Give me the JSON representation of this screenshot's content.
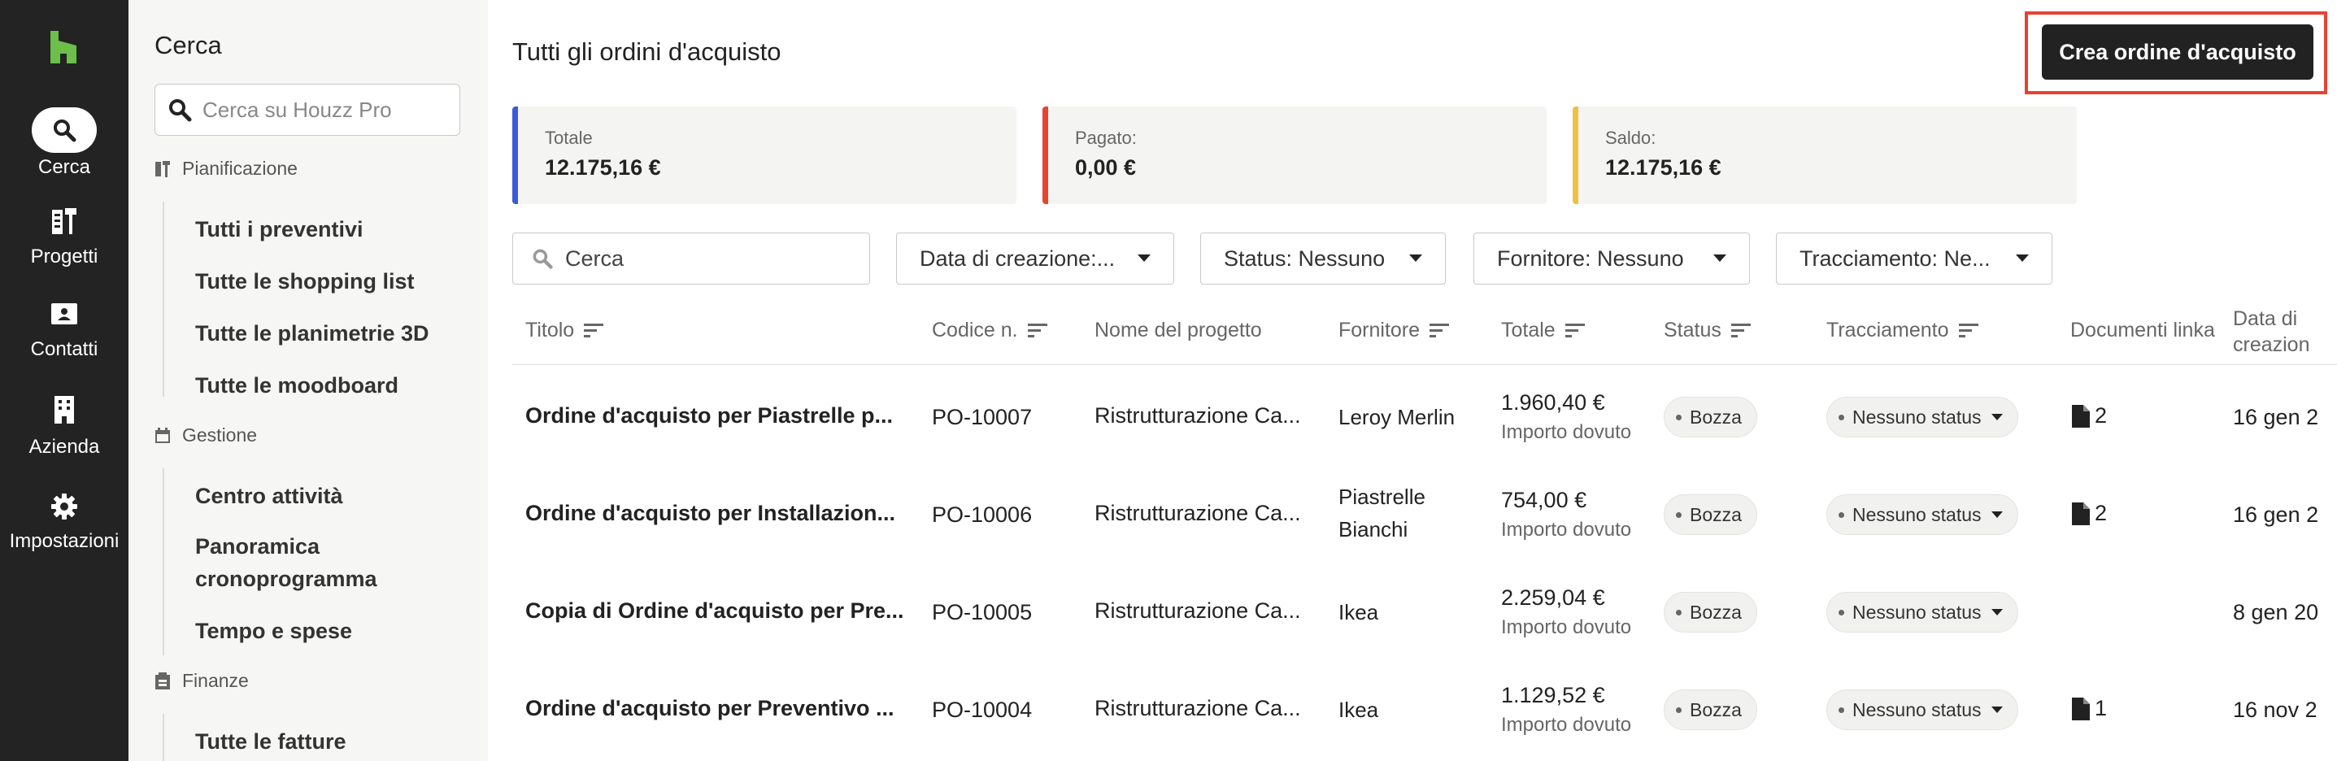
{
  "rail": {
    "items": [
      {
        "label": "Cerca",
        "icon": "search-icon"
      },
      {
        "label": "Progetti",
        "icon": "projects-icon"
      },
      {
        "label": "Contatti",
        "icon": "contacts-icon"
      },
      {
        "label": "Azienda",
        "icon": "building-icon"
      },
      {
        "label": "Impostazioni",
        "icon": "gear-icon"
      }
    ],
    "colors": {
      "bg": "#232323",
      "logo": "#6cbf4b"
    }
  },
  "sidebar": {
    "title": "Cerca",
    "search_placeholder": "Cerca su Houzz Pro",
    "sections": [
      {
        "label": "Pianificazione",
        "items": [
          "Tutti i preventivi",
          "Tutte le shopping list",
          "Tutte le planimetrie 3D",
          "Tutte le moodboard"
        ]
      },
      {
        "label": "Gestione",
        "items": [
          "Centro attività",
          "Panoramica cronoprogramma",
          "Tempo e spese"
        ]
      },
      {
        "label": "Finanze",
        "items": [
          "Tutte le fatture"
        ]
      }
    ]
  },
  "main": {
    "title": "Tutti gli ordini d'acquisto",
    "create_button": "Crea ordine d'acquisto",
    "summary": [
      {
        "label": "Totale",
        "value": "12.175,16 €",
        "color": "#3a5bd9"
      },
      {
        "label": "Pagato:",
        "value": "0,00 €",
        "color": "#e64331"
      },
      {
        "label": "Saldo:",
        "value": "12.175,16 €",
        "color": "#f0c040"
      }
    ],
    "filters": {
      "search_placeholder": "Cerca",
      "date": "Data di creazione:...",
      "status": "Status: Nessuno",
      "supplier": "Fornitore: Nessuno",
      "tracking": "Tracciamento: Ne..."
    },
    "columns": [
      "Titolo",
      "Codice n.",
      "Nome del progetto",
      "Fornitore",
      "Totale",
      "Status",
      "Tracciamento",
      "Documenti linka",
      "Data di",
      "creazion"
    ],
    "rows": [
      {
        "title": "Ordine d'acquisto per Piastrelle p...",
        "code": "PO-10007",
        "project": "Ristrutturazione Ca...",
        "supplier": "Leroy Merlin",
        "supplier2": "",
        "total": "1.960,40 €",
        "total_sub": "Importo dovuto",
        "status": "Bozza",
        "tracking": "Nessuno status",
        "docs": "2",
        "date": "16 gen 2"
      },
      {
        "title": "Ordine d'acquisto per Installazion...",
        "code": "PO-10006",
        "project": "Ristrutturazione Ca...",
        "supplier": "Piastrelle",
        "supplier2": "Bianchi",
        "total": "754,00 €",
        "total_sub": "Importo dovuto",
        "status": "Bozza",
        "tracking": "Nessuno status",
        "docs": "2",
        "date": "16 gen 2"
      },
      {
        "title": "Copia di Ordine d'acquisto per Pre...",
        "code": "PO-10005",
        "project": "Ristrutturazione Ca...",
        "supplier": "Ikea",
        "supplier2": "",
        "total": "2.259,04 €",
        "total_sub": "Importo dovuto",
        "status": "Bozza",
        "tracking": "Nessuno status",
        "docs": "",
        "date": "8 gen 20"
      },
      {
        "title": "Ordine d'acquisto per Preventivo ...",
        "code": "PO-10004",
        "project": "Ristrutturazione Ca...",
        "supplier": "Ikea",
        "supplier2": "",
        "total": "1.129,52 €",
        "total_sub": "Importo dovuto",
        "status": "Bozza",
        "tracking": "Nessuno status",
        "docs": "1",
        "date": "16 nov 2"
      }
    ]
  }
}
